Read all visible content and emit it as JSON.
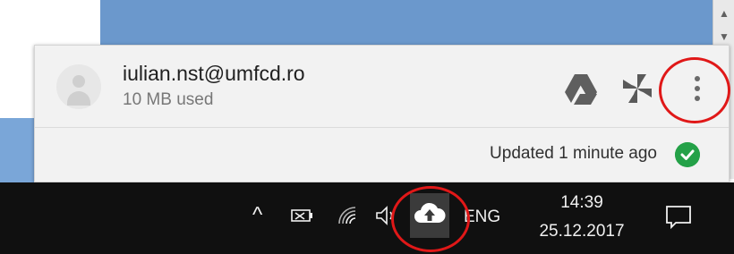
{
  "popup": {
    "account_email": "iulian.nst@umfcd.ro",
    "usage": "10 MB used",
    "status": "Updated 1 minute ago",
    "actions": [
      "google-drive-icon",
      "photos-pinwheel-icon",
      "more-options-icon"
    ]
  },
  "taskbar": {
    "language": "ENG",
    "time": "14:39",
    "date": "25.12.2017",
    "tray_icons": [
      "show-hidden-icons-chevron-icon",
      "battery-icon",
      "wifi-icon",
      "volume-icon",
      "backup-and-sync-cloud-icon"
    ],
    "notification_icon": "action-center-icon"
  },
  "colors": {
    "status_ok": "#24a148",
    "highlight_ring": "#e01818",
    "taskbar_bg": "#101010",
    "panel_bg": "#f2f2f2"
  }
}
